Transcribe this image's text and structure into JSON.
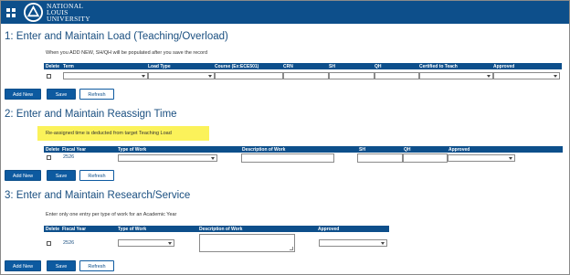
{
  "header": {
    "logo_lines": [
      "NATIONAL",
      "LOUIS",
      "UNIVERSITY"
    ],
    "menu_icon": "grid-icon",
    "logo_icon": "nlu-emblem-icon"
  },
  "buttons": {
    "add_new": "Add New",
    "save": "Save",
    "refresh": "Refresh"
  },
  "section1": {
    "title": "1: Enter and Maintain Load (Teaching/Overload)",
    "note": "When you ADD NEW, SH/QH will be populated after you save the record",
    "columns": [
      "Delete",
      "Term",
      "Load Type",
      "Course (Ex:ECE501)",
      "CRN",
      "SH",
      "QH",
      "Certified to Teach",
      "Approved"
    ]
  },
  "section2": {
    "title": "2: Enter and Maintain Reassign Time",
    "note": "Re-assigned time is deducted from target Teaching Load",
    "columns": [
      "Delete",
      "Fiscal Year",
      "Type of Work",
      "Description of Work",
      "SH",
      "QH",
      "Approved"
    ],
    "row": {
      "fiscal_year": "2526"
    },
    "highlight_color": "#fbf25a"
  },
  "section3": {
    "title": "3: Enter and Maintain Research/Service",
    "note": "Enter only one entry per type of work for an Academic Year",
    "columns": [
      "Delete",
      "Fiscal Year",
      "Type of Work",
      "Description of Work",
      "Approved"
    ],
    "row": {
      "fiscal_year": "2526"
    }
  },
  "colors": {
    "brand": "#0d4f8b",
    "title": "#1a4f80"
  }
}
